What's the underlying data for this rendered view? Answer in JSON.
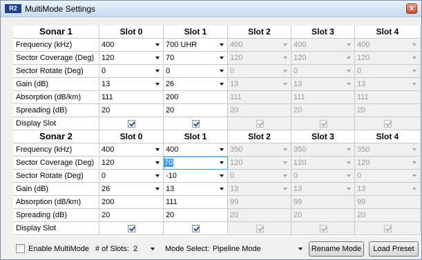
{
  "window": {
    "title": "MultiMode Settings",
    "icon_text": "R2",
    "close_label": "x"
  },
  "slots": [
    "Slot 0",
    "Slot 1",
    "Slot 2",
    "Slot 3",
    "Slot 4"
  ],
  "sonar1": {
    "title": "Sonar 1",
    "labels": {
      "freq": "Frequency (kHz)",
      "sector": "Sector Coverage (Deg)",
      "rotate": "Sector Rotate (Deg)",
      "gain": "Gain (dB)",
      "absorption": "Absorption (dB/km)",
      "spreading": "Spreading (dB)",
      "display": "Display Slot"
    },
    "freq": [
      "400",
      "700 UHR",
      "400",
      "400",
      "400"
    ],
    "sector": [
      "120",
      "70",
      "120",
      "120",
      "120"
    ],
    "rotate": [
      "0",
      "0",
      "0",
      "0",
      "0"
    ],
    "gain": [
      "13",
      "26",
      "13",
      "13",
      "13"
    ],
    "absorption": [
      "111",
      "200",
      "111",
      "111",
      "111"
    ],
    "spreading": [
      "20",
      "20",
      "20",
      "20",
      "20"
    ],
    "display": [
      true,
      true,
      true,
      true,
      true
    ]
  },
  "sonar2": {
    "title": "Sonar 2",
    "labels": {
      "freq": "Frequency (kHz)",
      "sector": "Sector Coverage (Deg)",
      "rotate": "Sector Rotate (Deg)",
      "gain": "Gain (dB)",
      "absorption": "Absorption (dB/km)",
      "spreading": "Spreading (dB)",
      "display": "Display Slot"
    },
    "freq": [
      "400",
      "400",
      "350",
      "350",
      "350"
    ],
    "sector": [
      "120",
      "70",
      "120",
      "120",
      "120"
    ],
    "rotate": [
      "0",
      "-10",
      "0",
      "0",
      "0"
    ],
    "gain": [
      "26",
      "13",
      "13",
      "13",
      "13"
    ],
    "absorption": [
      "200",
      "111",
      "99",
      "99",
      "99"
    ],
    "spreading": [
      "20",
      "20",
      "20",
      "20",
      "20"
    ],
    "display": [
      true,
      true,
      true,
      true,
      true
    ]
  },
  "footer": {
    "enable_label": "Enable MultiMode",
    "enable_checked": false,
    "slots_label": "# of Slots:",
    "slots_value": "2",
    "mode_label": "Mode Select:",
    "mode_value": "Pipeline Mode",
    "rename_label": "Rename Mode",
    "load_label": "Load Preset"
  },
  "colors": {
    "selection": "#3399ff",
    "disabled_text": "#9a9a9a",
    "title_gradient_top": "#eaf2fb"
  }
}
